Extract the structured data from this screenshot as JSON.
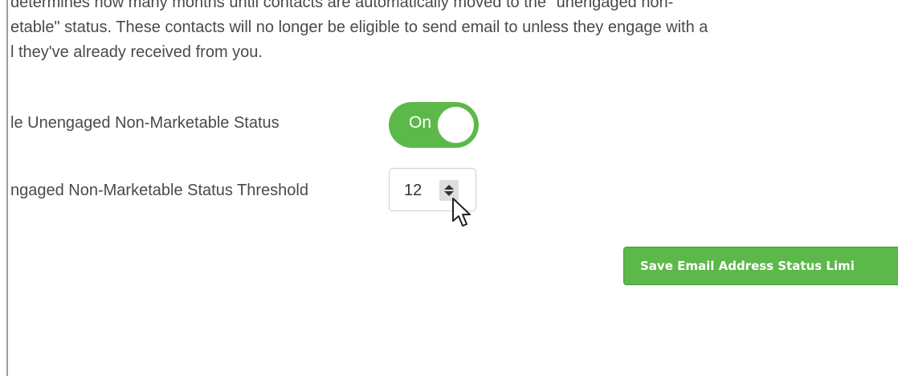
{
  "description": {
    "lines": [
      "determines how many months until contacts are automatically moved to the \"unengaged non-",
      "etable\" status. These contacts will no longer be eligible to send email to unless they engage with a",
      "l they've already received from you."
    ]
  },
  "toggle_row": {
    "label": "le Unengaged Non-Marketable Status",
    "toggle_text": "On",
    "state": "on",
    "color": "#5db84a"
  },
  "threshold_row": {
    "label": "ngaged Non-Marketable Status Threshold",
    "value": "12"
  },
  "save_button": {
    "label": "Save Email Address Status Limi",
    "color": "#5db84a"
  },
  "cursor": {
    "icon": "pointer-arrow-icon"
  }
}
